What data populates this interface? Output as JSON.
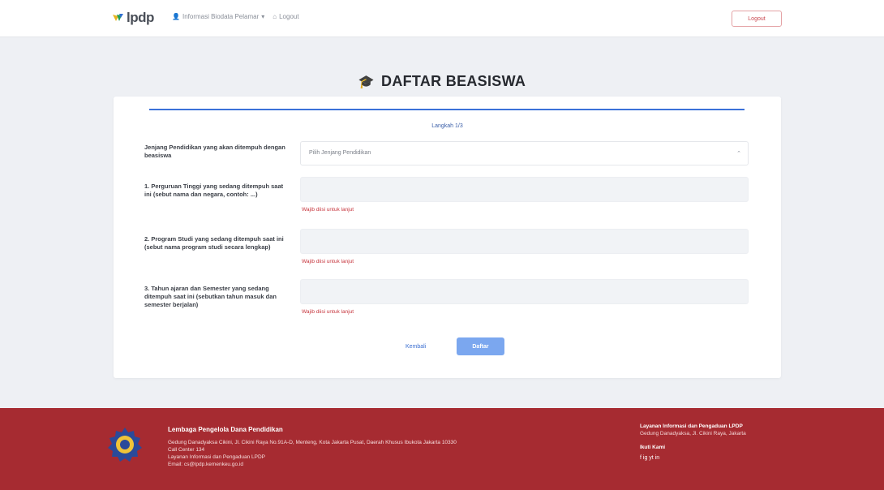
{
  "nav": {
    "logo_text": "lpdp",
    "link_profile": "Informasi Biodata Pelamar",
    "link_account": "Logout",
    "logout_label": "Logout"
  },
  "page": {
    "title": "DAFTAR BEASISWA"
  },
  "form": {
    "step_label": "Langkah 1/3",
    "progress_fraction": 1.0,
    "questions": [
      {
        "label": "Jenjang Pendidikan yang akan ditempuh dengan beasiswa",
        "type": "select",
        "value": "Pilih Jenjang Pendidikan",
        "error": ""
      },
      {
        "label": "1. Perguruan Tinggi yang sedang ditempuh saat ini (sebut nama dan negara, contoh: ...)",
        "type": "input",
        "value": "",
        "error": "Wajib diisi untuk lanjut"
      },
      {
        "label": "2. Program Studi yang sedang ditempuh saat ini (sebut nama program studi secara lengkap)",
        "type": "input",
        "value": "",
        "error": "Wajib diisi untuk lanjut"
      },
      {
        "label": "3. Tahun ajaran dan Semester yang sedang ditempuh saat ini (sebutkan tahun masuk dan semester berjalan)",
        "type": "input",
        "value": "",
        "error": "Wajib diisi untuk lanjut"
      }
    ],
    "back_label": "Kembali",
    "submit_label": "Daftar"
  },
  "footer": {
    "org_name": "Lembaga Pengelola Dana Pendidikan",
    "address_lines": [
      "Gedung Danadyaksa Cikini, Jl. Cikini Raya No.91A-D, Menteng, Kota Jakarta Pusat, Daerah Khusus Ibukota Jakarta 10330",
      "Call Center 134",
      "Layanan Informasi dan Pengaduan LPDP",
      "Email: cs@lpdp.kemenkeu.go.id"
    ],
    "right_heading": "Layanan Informasi dan Pengaduan LPDP",
    "right_sub": "Gedung Danadyaksa, Jl. Cikini Raya, Jakarta",
    "follow_label": "Ikuti Kami",
    "social_label": "f  ig  yt  in"
  },
  "colors": {
    "accent": "#3b72d9",
    "submit": "#7ba7ef",
    "error": "#c6343c",
    "footer_bg": "#a62b31",
    "logout_border": "#e4a2a5"
  }
}
